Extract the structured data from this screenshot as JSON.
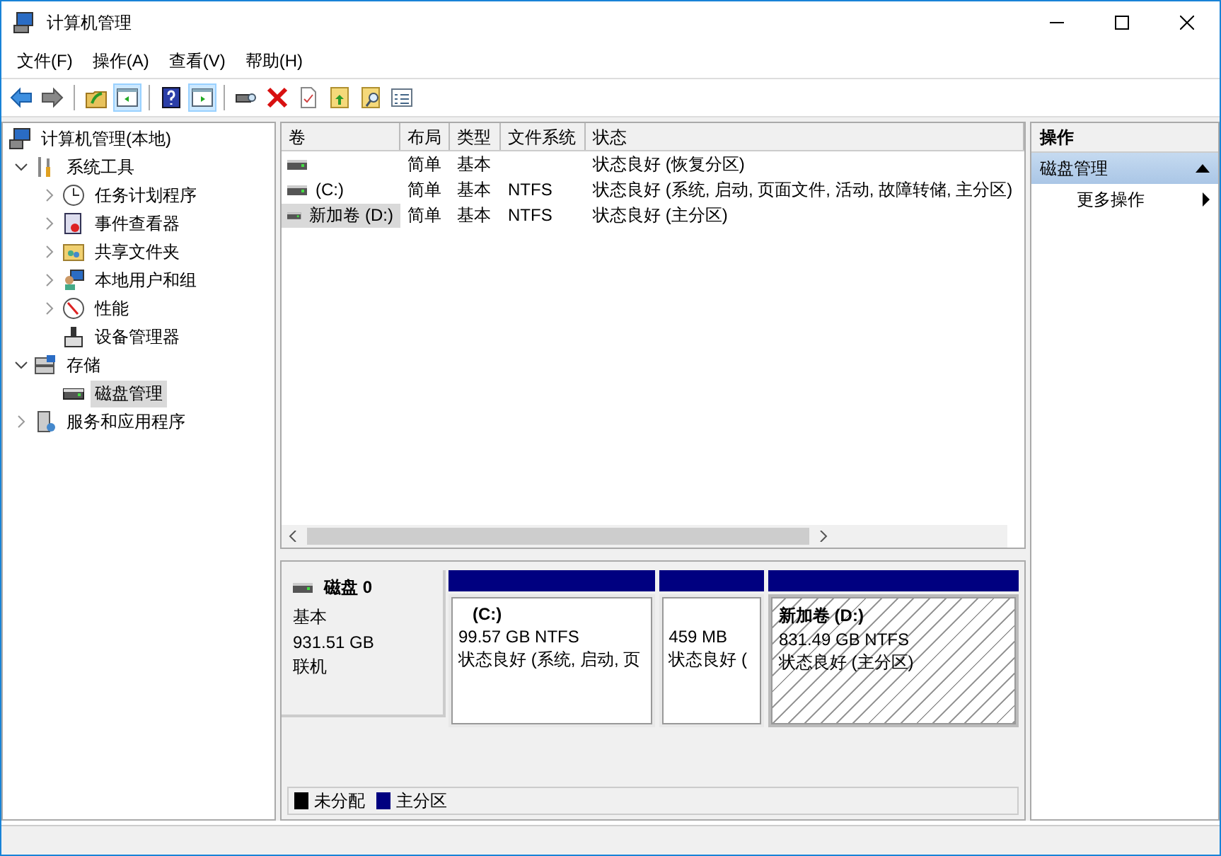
{
  "window": {
    "title": "计算机管理"
  },
  "menu": [
    "文件(F)",
    "操作(A)",
    "查看(V)",
    "帮助(H)"
  ],
  "toolbar": [
    {
      "kind": "back",
      "pressed": false
    },
    {
      "kind": "forward",
      "pressed": false
    },
    {
      "kind": "sep"
    },
    {
      "kind": "up",
      "pressed": false
    },
    {
      "kind": "tree",
      "pressed": true
    },
    {
      "kind": "sep"
    },
    {
      "kind": "help",
      "pressed": false
    },
    {
      "kind": "actionpane",
      "pressed": true
    },
    {
      "kind": "sep"
    },
    {
      "kind": "disk",
      "pressed": false
    },
    {
      "kind": "delete",
      "pressed": false
    },
    {
      "kind": "properties",
      "pressed": false
    },
    {
      "kind": "folderup",
      "pressed": false
    },
    {
      "kind": "foldersearch",
      "pressed": false
    },
    {
      "kind": "list",
      "pressed": false
    }
  ],
  "tree": [
    {
      "label": "计算机管理(本地)",
      "kind": "computer",
      "selected": false,
      "children": [
        {
          "label": "系统工具",
          "kind": "tools",
          "expanded": true,
          "selected": false,
          "children": [
            {
              "label": "任务计划程序",
              "kind": "clock",
              "expanded": false,
              "selected": false
            },
            {
              "label": "事件查看器",
              "kind": "log",
              "expanded": false,
              "selected": false
            },
            {
              "label": "共享文件夹",
              "kind": "share",
              "expanded": false,
              "selected": false
            },
            {
              "label": "本地用户和组",
              "kind": "users",
              "expanded": false,
              "selected": false
            },
            {
              "label": "性能",
              "kind": "perf",
              "expanded": false,
              "selected": false
            },
            {
              "label": "设备管理器",
              "kind": "device",
              "selected": false
            }
          ]
        },
        {
          "label": "存储",
          "kind": "storage",
          "expanded": true,
          "selected": false,
          "children": [
            {
              "label": "磁盘管理",
              "kind": "disk",
              "selected": true
            }
          ]
        },
        {
          "label": "服务和应用程序",
          "kind": "services",
          "expanded": false,
          "selected": false
        }
      ]
    }
  ],
  "volumes": {
    "columns": [
      "卷",
      "布局",
      "类型",
      "文件系统",
      "状态"
    ],
    "rows": [
      {
        "cells": [
          "",
          "简单",
          "基本",
          "",
          "状态良好 (恢复分区)"
        ],
        "selected": false
      },
      {
        "cells": [
          "(C:)",
          "简单",
          "基本",
          "NTFS",
          "状态良好 (系统, 启动, 页面文件, 活动, 故障转储, 主分区)"
        ],
        "selected": false
      },
      {
        "cells": [
          "新加卷 (D:)",
          "简单",
          "基本",
          "NTFS",
          "状态良好 (主分区)"
        ],
        "selected": true
      }
    ]
  },
  "disk": {
    "name": "磁盘 0",
    "type": "基本",
    "size": "931.51 GB",
    "status": "联机",
    "partitions": [
      {
        "title": "(C:)",
        "size": "99.57 GB NTFS",
        "status": "状态良好 (系统, 启动, 页",
        "selected": false,
        "color": "#000080"
      },
      {
        "size": "459 MB",
        "status": "状态良好 (",
        "selected": false,
        "color": "#000080"
      },
      {
        "title": "新加卷  (D:)",
        "size": "831.49 GB NTFS",
        "status": "状态良好 (主分区)",
        "selected": true,
        "color": "#000080"
      }
    ]
  },
  "legend": [
    {
      "label": "未分配",
      "color": "#000000"
    },
    {
      "label": "主分区",
      "color": "#000080"
    }
  ],
  "actions": {
    "title": "操作",
    "sections": [
      {
        "label": "磁盘管理",
        "expanded": true,
        "items": [
          "更多操作"
        ]
      }
    ]
  }
}
